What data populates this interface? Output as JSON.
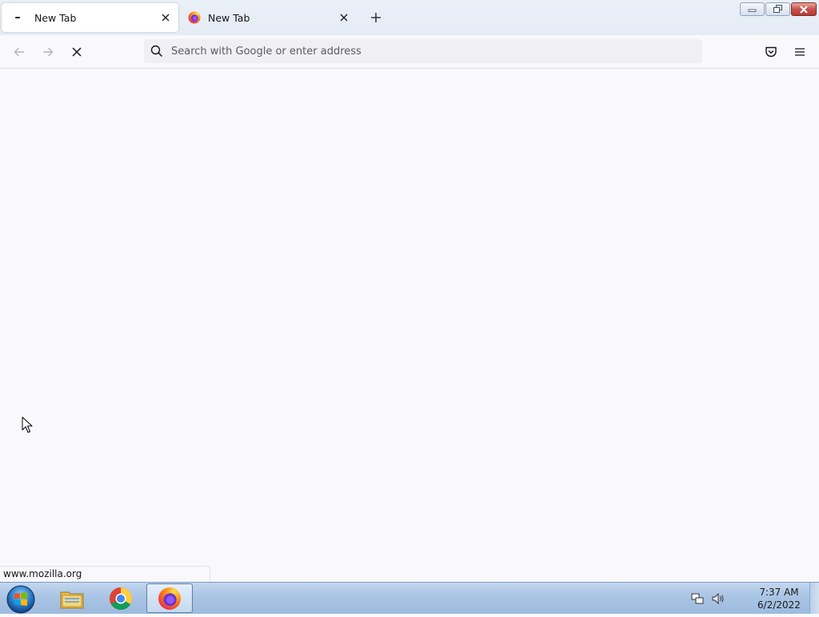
{
  "browser": {
    "tabs": [
      {
        "title": "New Tab",
        "state": "loading",
        "icon": "loading-icon",
        "active": true
      },
      {
        "title": "New Tab",
        "state": "loaded",
        "icon": "firefox-icon",
        "active": false
      }
    ],
    "new_tab_icon": "plus-icon",
    "window_controls": [
      "minimize-icon",
      "restore-icon",
      "close-icon"
    ],
    "nav": {
      "back_icon": "back-arrow-icon",
      "forward_icon": "forward-arrow-icon",
      "stop_icon": "stop-icon",
      "search_placeholder": "Search with Google or enter address",
      "search_value": "",
      "pocket_icon": "pocket-icon",
      "menu_icon": "hamburger-menu-icon"
    },
    "status_text": "www.mozilla.org"
  },
  "taskbar": {
    "start_icon": "windows-start-icon",
    "pinned": [
      "file-explorer-icon",
      "chrome-icon",
      "firefox-icon"
    ],
    "tray": [
      "network-icon",
      "volume-icon"
    ],
    "time": "7:37 AM",
    "date": "6/2/2022"
  },
  "colors": {
    "tab_strip": "#e6ecf5",
    "toolbar": "#f9f9fb",
    "urlbar": "#f0f0f4",
    "taskbar": "#a9c4e4",
    "close_button": "#c75050"
  }
}
